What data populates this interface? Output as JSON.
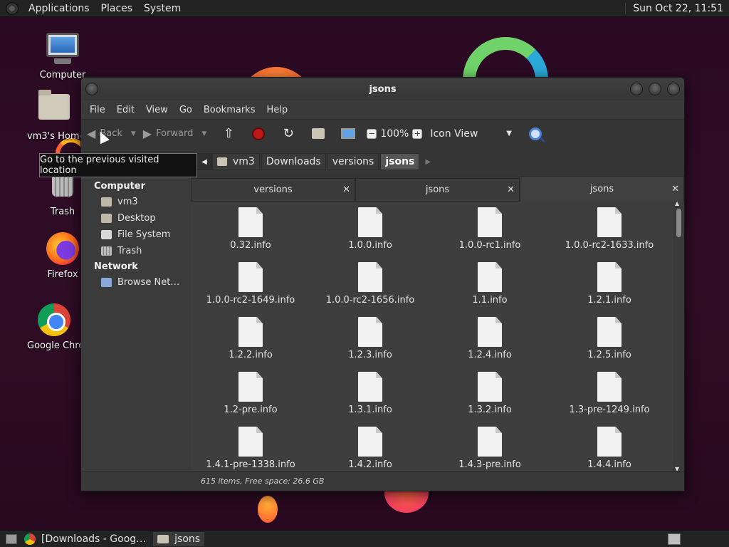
{
  "top_panel": {
    "menus": [
      "Applications",
      "Places",
      "System"
    ],
    "clock": "Sun Oct 22, 11:51"
  },
  "desktop_icons": [
    {
      "label": "Computer",
      "icon": "computer-icon"
    },
    {
      "label": "vm3's Home",
      "icon": "home-folder-icon"
    },
    {
      "label": "Trash",
      "icon": "trash-icon"
    },
    {
      "label": "Firefox",
      "icon": "firefox-icon"
    },
    {
      "label": "Google Chrome",
      "icon": "chrome-icon"
    }
  ],
  "window": {
    "title": "jsons",
    "menubar": [
      "File",
      "Edit",
      "View",
      "Go",
      "Bookmarks",
      "Help"
    ],
    "toolbar": {
      "back_label": "Back",
      "forward_label": "Forward",
      "zoom_level": "100%",
      "view_mode": "Icon View"
    },
    "breadcrumbs": [
      "vm3",
      "Downloads",
      "versions",
      "jsons"
    ],
    "sidebar": {
      "sections": [
        {
          "header": "Computer",
          "items": [
            "vm3",
            "Desktop",
            "File System",
            "Trash"
          ]
        },
        {
          "header": "Network",
          "items": [
            "Browse Net…"
          ]
        }
      ]
    },
    "tabs": [
      {
        "label": "versions",
        "active": false
      },
      {
        "label": "jsons",
        "active": false
      },
      {
        "label": "jsons",
        "active": true
      }
    ],
    "files": [
      "0.32.info",
      "1.0.0.info",
      "1.0.0-rc1.info",
      "1.0.0-rc2-1633.info",
      "1.0.0-rc2-1649.info",
      "1.0.0-rc2-1656.info",
      "1.1.info",
      "1.2.1.info",
      "1.2.2.info",
      "1.2.3.info",
      "1.2.4.info",
      "1.2.5.info",
      "1.2-pre.info",
      "1.3.1.info",
      "1.3.2.info",
      "1.3-pre-1249.info",
      "1.4.1-pre-1338.info",
      "1.4.2.info",
      "1.4.3-pre.info",
      "1.4.4.info"
    ],
    "status": "615 items, Free space: 26.6 GB"
  },
  "tooltip": "Go to the previous visited location",
  "taskbar": {
    "tasks": [
      {
        "label": "[Downloads - Goog…",
        "icon": "chrome-icon",
        "active": false
      },
      {
        "label": "jsons",
        "icon": "folder-icon",
        "active": true
      }
    ]
  }
}
